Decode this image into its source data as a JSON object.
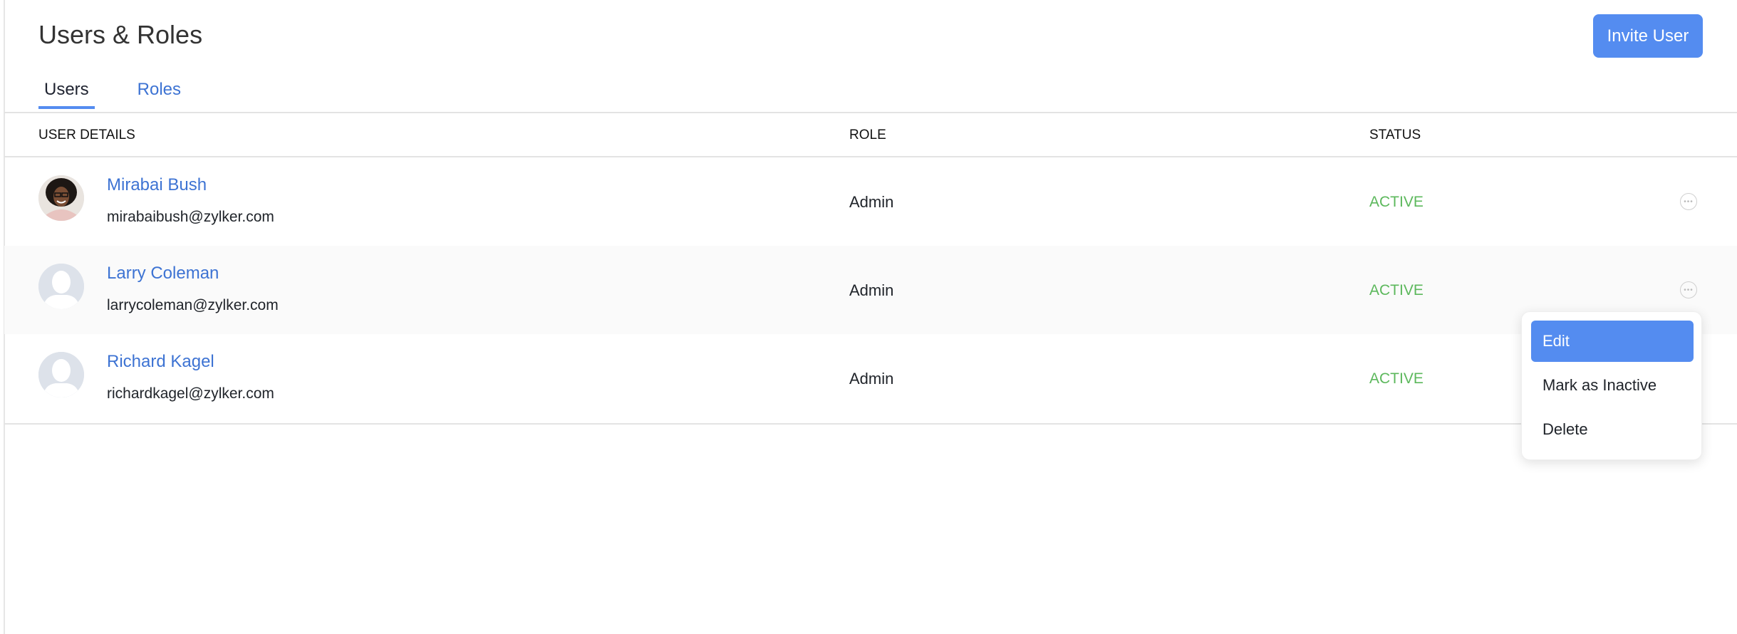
{
  "page": {
    "title": "Users & Roles",
    "invite_button": "Invite User"
  },
  "tabs": [
    {
      "label": "Users",
      "active": true
    },
    {
      "label": "Roles",
      "active": false
    }
  ],
  "table": {
    "columns": [
      "USER DETAILS",
      "ROLE",
      "STATUS"
    ],
    "rows": [
      {
        "name": "Mirabai Bush",
        "email": "mirabaibush@zylker.com",
        "role": "Admin",
        "status": "ACTIVE",
        "avatar": "photo"
      },
      {
        "name": "Larry Coleman",
        "email": "larrycoleman@zylker.com",
        "role": "Admin",
        "status": "ACTIVE",
        "avatar": "placeholder"
      },
      {
        "name": "Richard Kagel",
        "email": "richardkagel@zylker.com",
        "role": "Admin",
        "status": "ACTIVE",
        "avatar": "placeholder"
      }
    ]
  },
  "context_menu": {
    "items": [
      {
        "label": "Edit",
        "highlighted": true
      },
      {
        "label": "Mark as Inactive",
        "highlighted": false
      },
      {
        "label": "Delete",
        "highlighted": false
      }
    ]
  },
  "colors": {
    "accent": "#548cf0",
    "link": "#3d73d3",
    "status_active": "#5cb85c"
  }
}
